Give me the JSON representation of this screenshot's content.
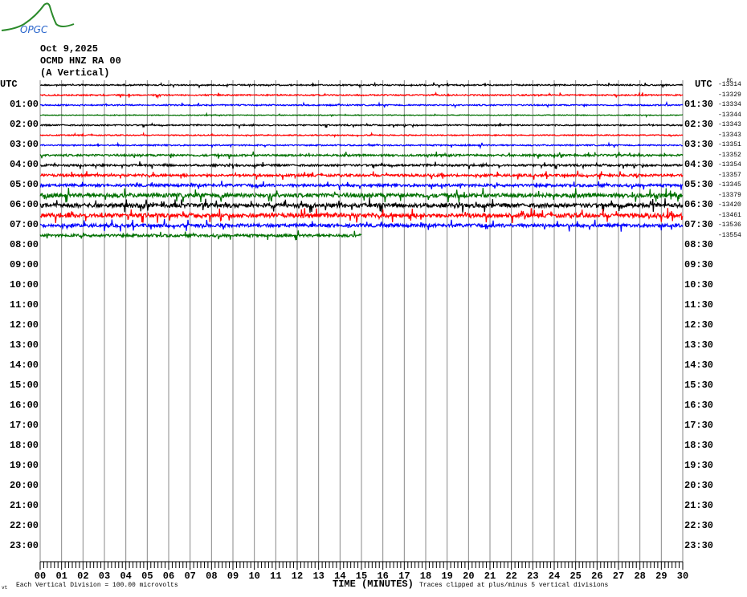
{
  "logo": {
    "text": "OPGC"
  },
  "header": {
    "date": "Oct 9,2025",
    "station": "OCMD HNZ RA 00",
    "component": "(A Vertical)"
  },
  "chart_data": {
    "type": "line",
    "title": "OCMD HNZ RA 00 (A Vertical) Oct 9,2025",
    "xlabel": "TIME (MINUTES)",
    "x_ticks": [
      "00",
      "01",
      "02",
      "03",
      "04",
      "05",
      "06",
      "07",
      "08",
      "09",
      "10",
      "11",
      "12",
      "13",
      "14",
      "15",
      "16",
      "17",
      "18",
      "19",
      "20",
      "21",
      "22",
      "23",
      "24",
      "25",
      "26",
      "27",
      "28",
      "29",
      "30"
    ],
    "xlim": [
      0,
      30
    ],
    "left_labels": [
      "UTC",
      "01:00",
      "02:00",
      "03:00",
      "04:00",
      "05:00",
      "06:00",
      "07:00",
      "08:00",
      "09:00",
      "10:00",
      "11:00",
      "12:00",
      "13:00",
      "14:00",
      "15:00",
      "16:00",
      "17:00",
      "18:00",
      "19:00",
      "20:00",
      "21:00",
      "22:00",
      "23:00"
    ],
    "right_labels": [
      "UTC",
      "01:30",
      "02:30",
      "03:30",
      "04:30",
      "05:30",
      "06:30",
      "07:30",
      "08:30",
      "09:30",
      "10:30",
      "11:30",
      "12:30",
      "13:30",
      "14:30",
      "15:30",
      "16:30",
      "17:30",
      "18:30",
      "19:30",
      "20:30",
      "21:30",
      "22:30",
      "23:30"
    ],
    "right_label_extra": "BC",
    "trace_offsets": [
      "-13314",
      "-13329",
      "-13334",
      "-13344",
      "-13343",
      "-13343",
      "-13351",
      "-13352",
      "-13354",
      "-13357",
      "-13345",
      "-13379",
      "-13420",
      "-13461",
      "-13536",
      "-13554"
    ],
    "trace_colors": [
      "#000000",
      "#ff0000",
      "#0000ff",
      "#007000"
    ],
    "trace_noise_level": [
      1,
      1,
      1,
      0.6,
      1,
      0.8,
      1,
      1.5,
      1.5,
      1.8,
      2,
      3,
      3,
      3,
      2.5,
      2
    ],
    "last_trace_end_minute": 15,
    "rows_total": 48,
    "vertical_division": "Each Vertical Division =  100.00 microvolts",
    "clip_note": "Traces clipped at plus/minus 5 vertical divisions",
    "corner_mark": "vt"
  }
}
